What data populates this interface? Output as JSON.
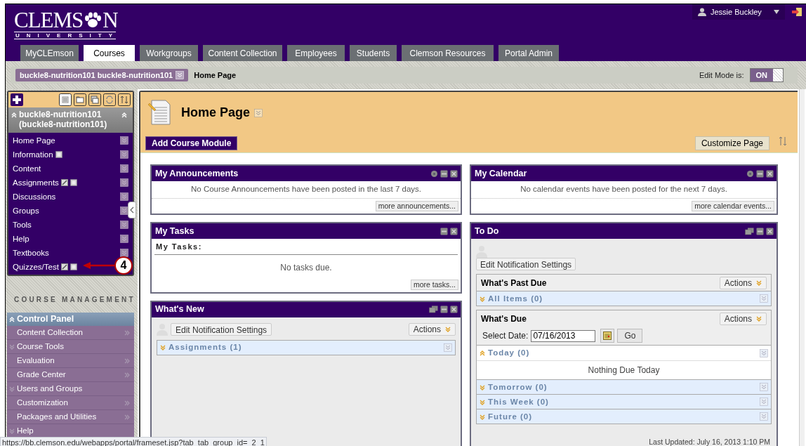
{
  "header": {
    "logo": {
      "wordmark_start": "CLEMS",
      "wordmark_end": "N",
      "subtitle": "UNIVERSITY"
    },
    "user": {
      "name": "Jessie Buckley"
    }
  },
  "tabs": [
    {
      "label": "MyCLEmson",
      "selected": false
    },
    {
      "label": "Courses",
      "selected": true
    },
    {
      "label": "Workgroups",
      "selected": false
    },
    {
      "label": "Content Collection",
      "selected": false
    },
    {
      "label": "Employees",
      "selected": false
    },
    {
      "label": "Students",
      "selected": false
    },
    {
      "label": "Clemson Resources",
      "selected": false
    },
    {
      "label": "Portal Admin",
      "selected": false
    }
  ],
  "breadcrumb": {
    "course": "buckle8-nutrition101 buckle8-nutrition101",
    "page": "Home Page",
    "edit_mode_label": "Edit Mode is:",
    "edit_mode": "ON",
    "edit_mode_on": true
  },
  "course_menu": {
    "title": "buckle8-nutrition101 (buckle8-nutrition101)",
    "items": [
      {
        "label": "Home Page",
        "edit_icon": false,
        "page_icon": false
      },
      {
        "label": "Information",
        "edit_icon": false,
        "page_icon": true
      },
      {
        "label": "Content",
        "edit_icon": false,
        "page_icon": false
      },
      {
        "label": "Assignments",
        "edit_icon": true,
        "page_icon": true
      },
      {
        "label": "Discussions",
        "edit_icon": false,
        "page_icon": false
      },
      {
        "label": "Groups",
        "edit_icon": false,
        "page_icon": false
      },
      {
        "label": "Tools",
        "edit_icon": false,
        "page_icon": false
      },
      {
        "label": "Help",
        "edit_icon": false,
        "page_icon": false
      },
      {
        "label": "Textbooks",
        "edit_icon": false,
        "page_icon": false
      },
      {
        "label": "Quizzes/Test",
        "edit_icon": true,
        "page_icon": true
      }
    ]
  },
  "callout": {
    "label": "4"
  },
  "course_management": {
    "heading": "COURSE MANAGEMENT",
    "control_panel": "Control Panel",
    "items": [
      {
        "label": "Content Collection",
        "kind": "link"
      },
      {
        "label": "Course Tools",
        "kind": "group"
      },
      {
        "label": "Evaluation",
        "kind": "link"
      },
      {
        "label": "Grade Center",
        "kind": "link"
      },
      {
        "label": "Users and Groups",
        "kind": "group"
      },
      {
        "label": "Customization",
        "kind": "link"
      },
      {
        "label": "Packages and Utilities",
        "kind": "link"
      },
      {
        "label": "Help",
        "kind": "group"
      }
    ]
  },
  "page_header": {
    "title": "Home Page",
    "add_button": "Add Course Module",
    "customize_button": "Customize Page"
  },
  "modules_left": [
    {
      "kind": "message",
      "title": "My Announcements",
      "has_settings": true,
      "has_popout": false,
      "message": "No Course Announcements have been posted in the last 7 days.",
      "more": "more announcements..."
    },
    {
      "kind": "tasks",
      "title": "My Tasks",
      "has_settings": false,
      "has_popout": false,
      "subheading": "My Tasks:",
      "message": "No tasks due.",
      "more": "more tasks..."
    },
    {
      "kind": "whats_new",
      "title": "What's New",
      "has_settings": false,
      "has_popout": true,
      "notify_button": "Edit Notification Settings",
      "actions": "Actions",
      "sections": [
        {
          "label": "Assignments (1)",
          "expanded": false
        }
      ]
    }
  ],
  "modules_right": [
    {
      "kind": "message",
      "title": "My Calendar",
      "has_settings": true,
      "has_popout": false,
      "message": "No calendar events have been posted for the next 7 days.",
      "more": "more calendar events..."
    },
    {
      "kind": "todo",
      "title": "To Do",
      "has_settings": false,
      "has_popout": true,
      "notify_button": "Edit Notification Settings",
      "past_due": {
        "heading": "What's Past Due",
        "actions": "Actions",
        "sections": [
          {
            "label": "All Items (0)",
            "expanded": false
          }
        ]
      },
      "due": {
        "heading": "What's Due",
        "actions": "Actions",
        "date_label": "Select Date:",
        "date": "07/16/2013",
        "go": "Go",
        "sections": [
          {
            "label": "Today (0)",
            "expanded": true,
            "empty_text": "Nothing Due Today"
          },
          {
            "label": "Tomorrow (0)",
            "expanded": false
          },
          {
            "label": "This Week (0)",
            "expanded": false
          },
          {
            "label": "Future (0)",
            "expanded": false
          }
        ]
      },
      "last_updated": "Last Updated: July 16, 2013 1:10 PM"
    }
  ],
  "status_bar": {
    "url": "https://bb.clemson.edu/webapps/portal/frameset.jsp?tab_tab_group_id=_2_1"
  }
}
